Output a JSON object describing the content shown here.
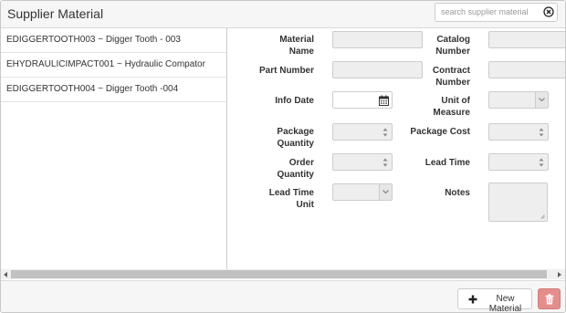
{
  "header": {
    "title": "Supplier Material",
    "search_placeholder": "search supplier material"
  },
  "list": {
    "items": [
      {
        "label": "EDIGGERTOOTH003 ~ Digger Tooth - 003"
      },
      {
        "label": "EHYDRAULICIMPACT001 ~ Hydraulic Compator"
      },
      {
        "label": "EDIGGERTOOTH004 ~ Digger Tooth -004"
      }
    ]
  },
  "form": {
    "material_name_l1": "Material",
    "material_name_l2": "Name",
    "catalog_number_l1": "Catalog",
    "catalog_number_l2": "Number",
    "part_number": "Part Number",
    "contract_number_l1": "Contract",
    "contract_number_l2": "Number",
    "info_date": "Info Date",
    "unit_of_measure_l1": "Unit of",
    "unit_of_measure_l2": "Measure",
    "package_quantity_l1": "Package",
    "package_quantity_l2": "Quantity",
    "package_cost": "Package Cost",
    "order_quantity_l1": "Order",
    "order_quantity_l2": "Quantity",
    "lead_time": "Lead Time",
    "lead_time_unit_l1": "Lead Time",
    "lead_time_unit_l2": "Unit",
    "notes": "Notes"
  },
  "footer": {
    "new_material_label": "New Material"
  },
  "icons": {
    "clear": "times-circle-icon",
    "calendar": "calendar-icon",
    "spinner": "spinner-arrows-icon",
    "select": "chevron-down-icon",
    "add": "plus-icon",
    "delete": "trash-icon"
  },
  "colors": {
    "delete_button": "#e48e8c",
    "header_bg": "#f6f6f6",
    "scroll_thumb": "#c1c1c1"
  }
}
